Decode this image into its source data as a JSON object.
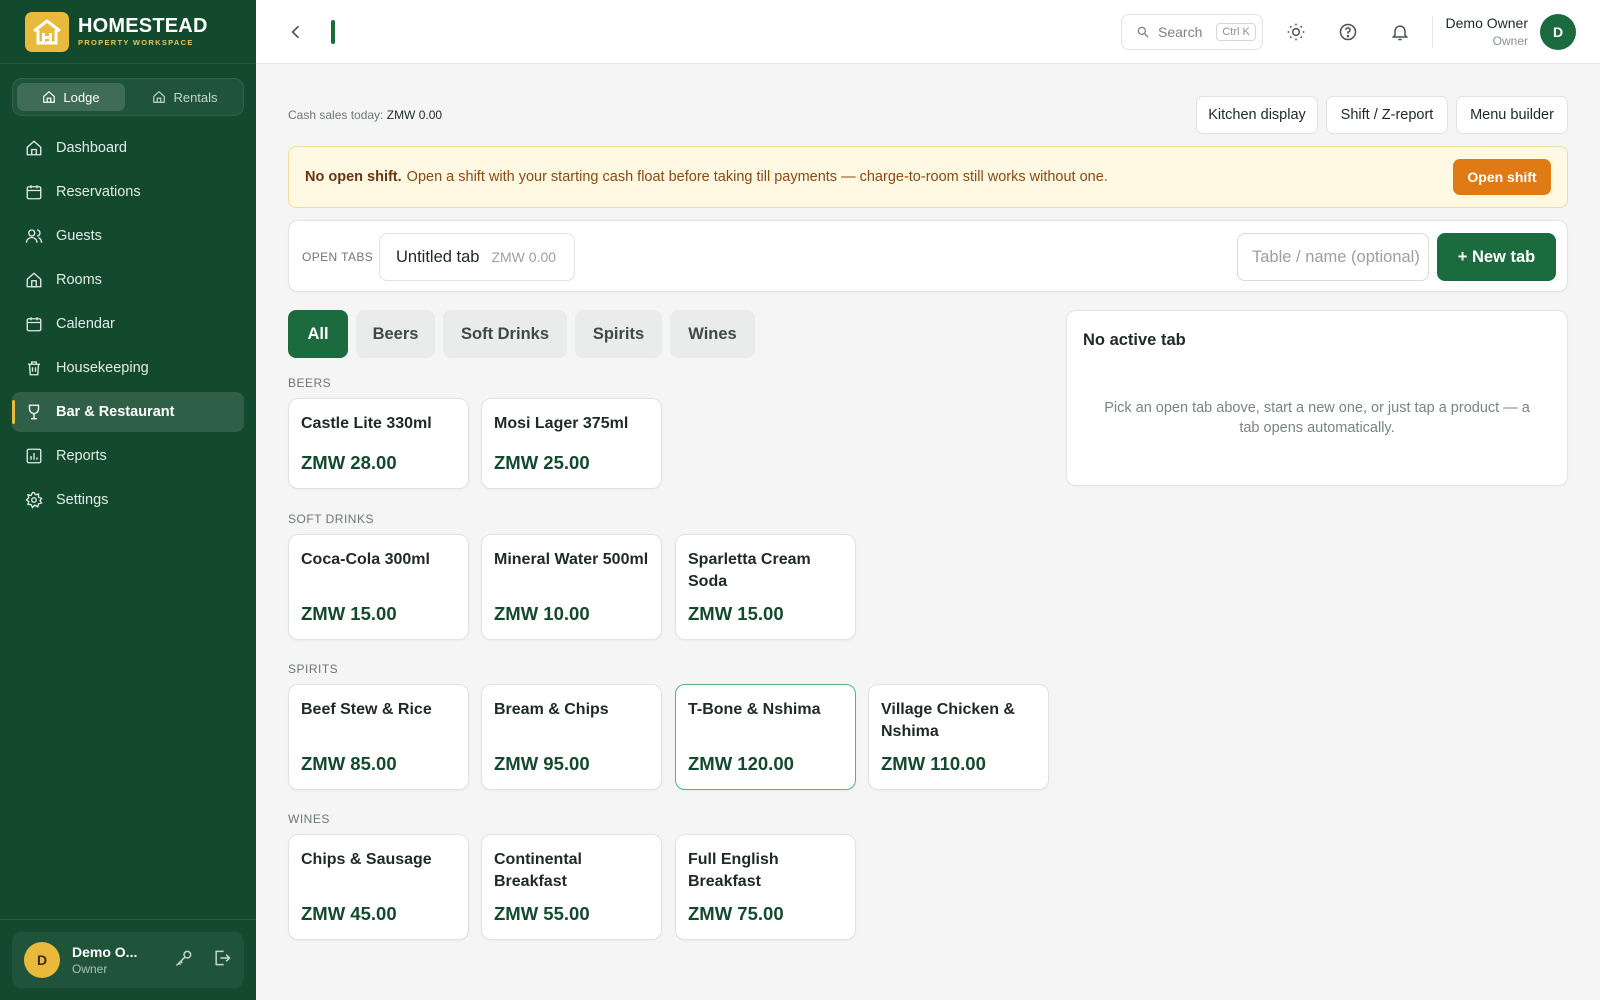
{
  "brand": {
    "name": "HOMESTEAD",
    "sub": "PROPERTY WORKSPACE"
  },
  "switcher": [
    {
      "label": "Lodge",
      "active": true
    },
    {
      "label": "Rentals",
      "active": false
    }
  ],
  "nav": [
    {
      "label": "Dashboard",
      "icon": "home-icon"
    },
    {
      "label": "Reservations",
      "icon": "calendar-icon"
    },
    {
      "label": "Guests",
      "icon": "users-icon"
    },
    {
      "label": "Rooms",
      "icon": "building-icon"
    },
    {
      "label": "Calendar",
      "icon": "calendar-icon"
    },
    {
      "label": "Housekeeping",
      "icon": "trash-icon"
    },
    {
      "label": "Bar & Restaurant",
      "icon": "cup-icon",
      "active": true
    },
    {
      "label": "Reports",
      "icon": "chart-icon"
    },
    {
      "label": "Settings",
      "icon": "gear-icon"
    }
  ],
  "sidebar_user": {
    "initial": "D",
    "name": "Demo O...",
    "role": "Owner"
  },
  "topbar": {
    "search_label": "Search",
    "search_shortcut": "Ctrl K",
    "user_name": "Demo Owner",
    "user_role": "Owner",
    "user_initial": "D"
  },
  "header": {
    "cash_label": "Cash sales today:",
    "cash_value": "ZMW 0.00",
    "buttons": [
      "Kitchen display",
      "Shift / Z-report",
      "Menu builder"
    ]
  },
  "alert": {
    "title": "No open shift.",
    "text": "Open a shift with your starting cash float before taking till payments — charge-to-room still works without one.",
    "button": "Open shift"
  },
  "tabs": {
    "label": "OPEN TABS",
    "open": [
      {
        "name": "Untitled tab",
        "amount": "ZMW 0.00"
      }
    ],
    "input_placeholder": "Table / name (optional)",
    "new_button": "+ New tab"
  },
  "filters": [
    {
      "label": "All",
      "active": true
    },
    {
      "label": "Beers"
    },
    {
      "label": "Soft Drinks"
    },
    {
      "label": "Spirits"
    },
    {
      "label": "Wines"
    }
  ],
  "sections": [
    {
      "title": "BEERS",
      "items": [
        {
          "name": "Castle Lite 330ml",
          "price": "ZMW 28.00"
        },
        {
          "name": "Mosi Lager 375ml",
          "price": "ZMW 25.00"
        }
      ]
    },
    {
      "title": "SOFT DRINKS",
      "items": [
        {
          "name": "Coca-Cola 300ml",
          "price": "ZMW 15.00"
        },
        {
          "name": "Mineral Water 500ml",
          "price": "ZMW 10.00"
        },
        {
          "name": "Sparletta Cream Soda",
          "price": "ZMW 15.00"
        }
      ]
    },
    {
      "title": "SPIRITS",
      "items": [
        {
          "name": "Beef Stew & Rice",
          "price": "ZMW 85.00"
        },
        {
          "name": "Bream & Chips",
          "price": "ZMW 95.00"
        },
        {
          "name": "T-Bone & Nshima",
          "price": "ZMW 120.00",
          "highlighted": true
        },
        {
          "name": "Village Chicken & Nshima",
          "price": "ZMW 110.00"
        }
      ]
    },
    {
      "title": "WINES",
      "items": [
        {
          "name": "Chips & Sausage",
          "price": "ZMW 45.00"
        },
        {
          "name": "Continental Breakfast",
          "price": "ZMW 55.00"
        },
        {
          "name": "Full English Breakfast",
          "price": "ZMW 75.00"
        }
      ]
    }
  ],
  "active_tab_panel": {
    "title": "No active tab",
    "text": "Pick an open tab above, start a new one, or just tap a product — a tab opens automatically."
  },
  "colors": {
    "sidebar": "#134a2e",
    "accent": "#1b6b3e",
    "gold": "#e8b93a",
    "warning": "#e07a14"
  }
}
